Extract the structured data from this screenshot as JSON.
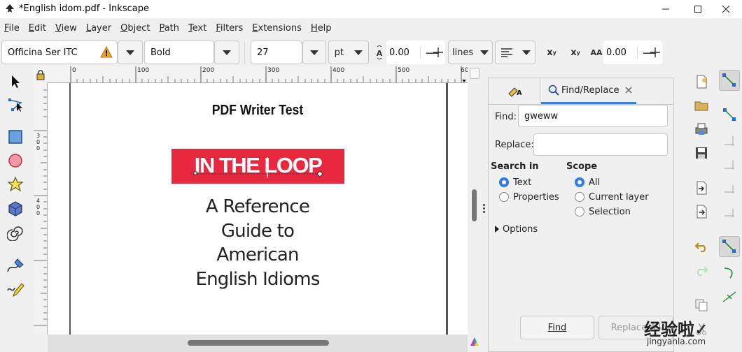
{
  "window": {
    "title": "*English idom.pdf - Inkscape"
  },
  "menu": [
    "File",
    "Edit",
    "View",
    "Layer",
    "Object",
    "Path",
    "Text",
    "Filters",
    "Extensions",
    "Help"
  ],
  "text_toolbar": {
    "font_family": "Officina Ser ITC",
    "font_style": "Bold",
    "font_size": "27",
    "unit": "pt",
    "line_spacing": "0.00",
    "line_spacing_mode": "lines",
    "letter_spacing": "0.00",
    "warning_color": "#f0a020"
  },
  "rulers": {
    "h_ticks": [
      "0",
      "100",
      "200",
      "300",
      "400",
      "500",
      "60"
    ],
    "v_ticks": [
      [
        "3",
        "0",
        "0"
      ],
      [
        "4",
        "0",
        "0"
      ]
    ]
  },
  "document": {
    "title": "PDF Writer Test",
    "banner_text": "IN THE LOOP",
    "banner_color": "#e8283f",
    "subtitle_lines": [
      "A Reference",
      "Guide to",
      "American",
      "English Idioms"
    ]
  },
  "find_panel": {
    "tab_label": "Find/Replace",
    "find_label": "Find:",
    "find_value": "gweww",
    "replace_label": "Replace:",
    "replace_value": "",
    "search_in_label": "Search in",
    "search_in_options": [
      "Text",
      "Properties"
    ],
    "scope_label": "Scope",
    "scope_options": [
      "All",
      "Current layer",
      "Selection"
    ],
    "options_label": "Options",
    "find_button": "Find",
    "replace_all_button": "Replace All",
    "accent_color": "#2f7ae5"
  },
  "watermark": {
    "text": "经验啦✓",
    "sub": "jingyanla.com"
  }
}
